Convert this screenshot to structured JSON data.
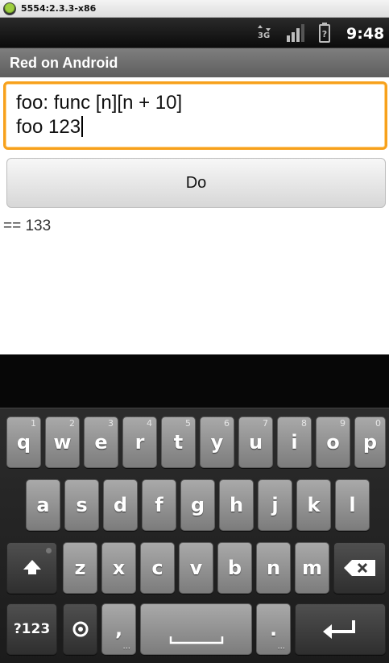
{
  "window": {
    "title": "5554:2.3.3-x86"
  },
  "status_bar": {
    "network_label": "3G",
    "time": "9:48"
  },
  "app": {
    "title": "Red on Android",
    "editor": {
      "line1": "foo: func [n][n + 10]",
      "line2": "foo 123"
    },
    "do_button_label": "Do",
    "result": "== 133"
  },
  "keyboard": {
    "row1": [
      {
        "label": "q",
        "alt": "1"
      },
      {
        "label": "w",
        "alt": "2"
      },
      {
        "label": "e",
        "alt": "3"
      },
      {
        "label": "r",
        "alt": "4"
      },
      {
        "label": "t",
        "alt": "5"
      },
      {
        "label": "y",
        "alt": "6"
      },
      {
        "label": "u",
        "alt": "7"
      },
      {
        "label": "i",
        "alt": "8"
      },
      {
        "label": "o",
        "alt": "9"
      },
      {
        "label": "p",
        "alt": "0"
      }
    ],
    "row2": [
      "a",
      "s",
      "d",
      "f",
      "g",
      "h",
      "j",
      "k",
      "l"
    ],
    "row3": [
      "z",
      "x",
      "c",
      "v",
      "b",
      "n",
      "m"
    ],
    "symbols_label": "?123",
    "comma_label": ",",
    "period_label": "."
  }
}
